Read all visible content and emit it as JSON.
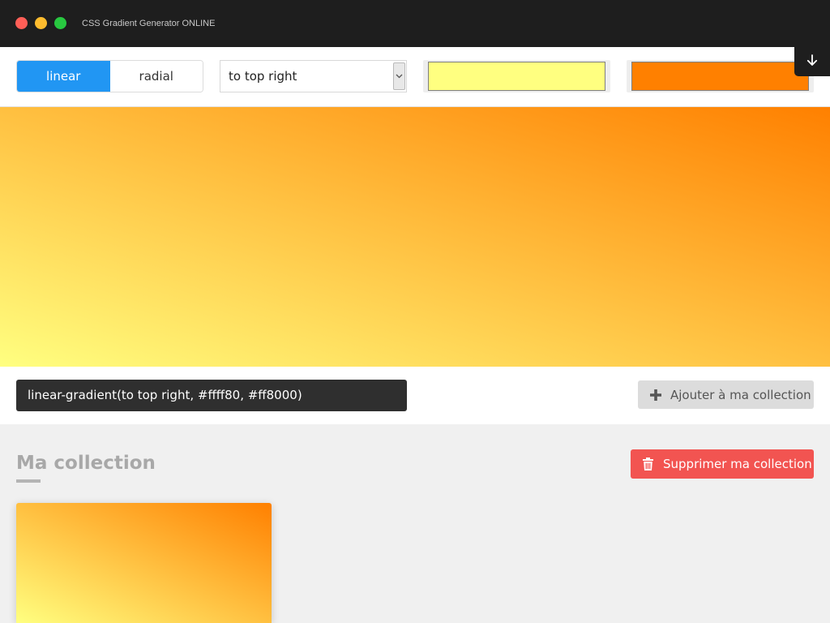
{
  "window": {
    "title": "CSS Gradient Generator ONLINE"
  },
  "toolbar": {
    "types": [
      {
        "label": "linear",
        "active": true
      },
      {
        "label": "radial",
        "active": false
      }
    ],
    "direction": "to top right",
    "color1": "#ffff80",
    "color2": "#ff8000"
  },
  "icons": {
    "download": "arrow-down-icon",
    "add": "plus-icon",
    "delete": "trash-icon",
    "dropdown": "chevron-down-icon"
  },
  "preview": {
    "gradient": "linear-gradient(to top right, #ffff80, #ff8000)"
  },
  "code": {
    "text": "linear-gradient(to top right, #ffff80, #ff8000)"
  },
  "actions": {
    "add_label": "Ajouter à ma collection",
    "delete_label": "Supprimer ma collection"
  },
  "collection": {
    "title": "Ma collection",
    "items": [
      {
        "gradient": "linear-gradient(to top right, #ffff80, #ff8000)"
      }
    ]
  },
  "colors": {
    "accent": "#2196f3",
    "danger": "#f25451"
  }
}
